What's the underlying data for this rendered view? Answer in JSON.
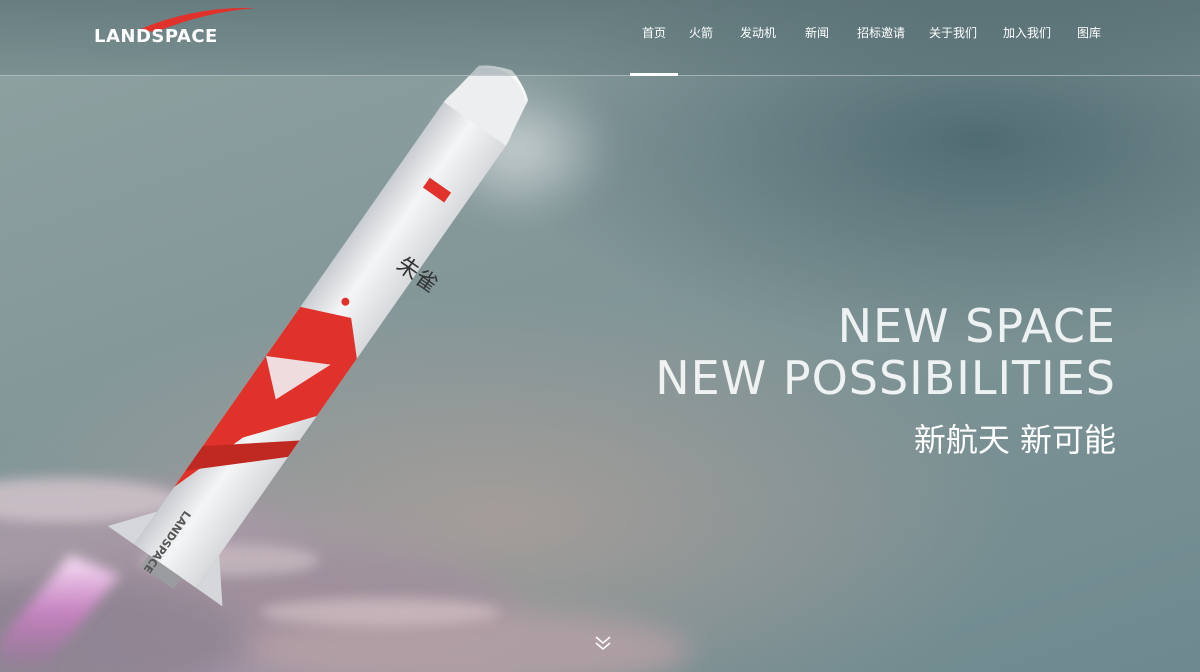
{
  "brand": {
    "logo_text": "LANDSPACE"
  },
  "nav": {
    "items": [
      {
        "label": "首页",
        "active": true
      },
      {
        "label": "火箭"
      },
      {
        "label": "发动机"
      },
      {
        "label": "新闻"
      },
      {
        "label": "招标邀请"
      },
      {
        "label": "关于我们"
      },
      {
        "label": "加入我们"
      },
      {
        "label": "图库"
      }
    ]
  },
  "hero": {
    "headline_line1": "NEW SPACE",
    "headline_line2": "NEW POSSIBILITIES",
    "headline_cn": "新航天 新可能",
    "rocket_name_cn": "朱雀",
    "rocket_logo_text": "LANDSPACE"
  },
  "icons": {
    "scroll": "double-chevron-down-icon"
  },
  "colors": {
    "brand_red": "#e0312b",
    "nav_text": "#ffffff"
  }
}
